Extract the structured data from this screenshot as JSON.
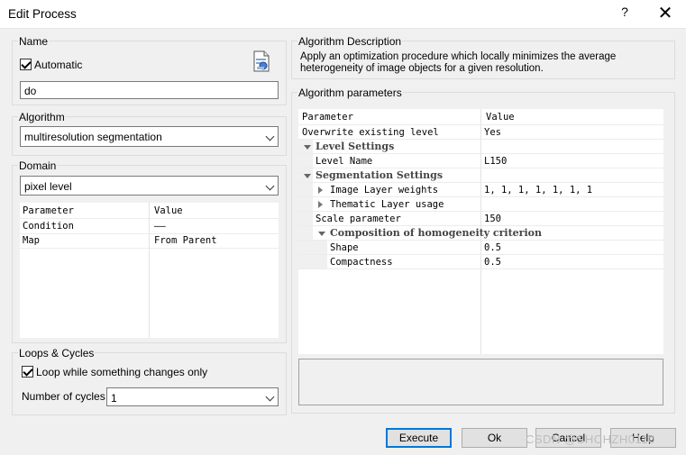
{
  "window": {
    "title": "Edit Process",
    "help_glyph": "?",
    "close_glyph": "✕"
  },
  "name_group": {
    "label": "Name",
    "automatic_label": "Automatic",
    "automatic_checked": true,
    "name_value": "do"
  },
  "algorithm_group": {
    "label": "Algorithm",
    "selected": "multiresolution segmentation"
  },
  "domain_group": {
    "label": "Domain",
    "selected": "pixel level",
    "columns": {
      "parameter": "Parameter",
      "value": "Value"
    },
    "rows": [
      {
        "parameter": "Condition",
        "value": "——"
      },
      {
        "parameter": "Map",
        "value": "From Parent"
      }
    ]
  },
  "loops_group": {
    "label": "Loops & Cycles",
    "loop_label": "Loop while something changes only",
    "loop_checked": true,
    "cycles_label": "Number of cycles",
    "cycles_value": "1"
  },
  "description": {
    "label": "Algorithm Description",
    "text": "Apply an optimization procedure which locally minimizes the average heterogeneity of image objects for a given resolution."
  },
  "parameters": {
    "label": "Algorithm parameters",
    "header_parameter": "Parameter",
    "header_value": "Value",
    "rows": [
      {
        "name": "Overwrite existing level",
        "value": "Yes"
      },
      {
        "name": "Level Settings",
        "value": ""
      },
      {
        "name": "Level Name",
        "value": "L150"
      },
      {
        "name": "Segmentation Settings",
        "value": ""
      },
      {
        "name": "Image Layer weights",
        "value": "1, 1, 1, 1, 1, 1, 1"
      },
      {
        "name": "Thematic Layer usage",
        "value": ""
      },
      {
        "name": "Scale parameter",
        "value": "150"
      },
      {
        "name": "Composition of homogeneity criterion",
        "value": ""
      },
      {
        "name": "Shape",
        "value": "0.5"
      },
      {
        "name": "Compactness",
        "value": "0.5"
      }
    ]
  },
  "buttons": {
    "execute": "Execute",
    "ok": "Ok",
    "cancel": "Cancel",
    "help": "Help"
  },
  "watermark": "CSDN @SHCHZH0110"
}
